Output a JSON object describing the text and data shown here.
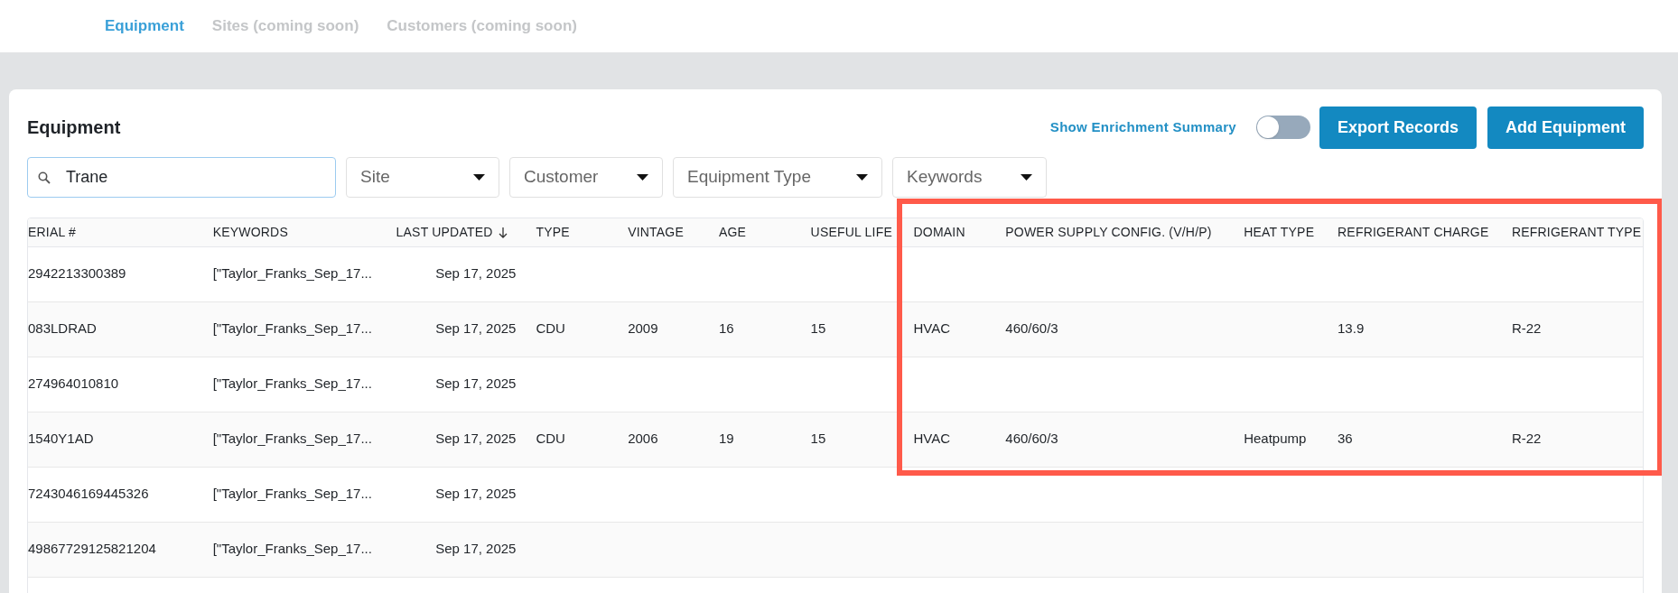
{
  "nav_tabs": [
    {
      "label": "Equipment",
      "selected": true
    },
    {
      "label": "Sites (coming soon)",
      "selected": false
    },
    {
      "label": "Customers (coming soon)",
      "selected": false
    }
  ],
  "card": {
    "title": "Equipment",
    "enrichment_toggle": {
      "label": "Show Enrichment Summary",
      "on": false
    },
    "buttons": [
      "Export Records",
      "Add Equipment"
    ]
  },
  "search": {
    "value": "Trane"
  },
  "filters": [
    "Site",
    "Customer",
    "Equipment Type",
    "Keywords"
  ],
  "table": {
    "columns": [
      "ERIAL #",
      "KEYWORDS",
      "LAST UPDATED",
      "TYPE",
      "VINTAGE",
      "AGE",
      "USEFUL LIFE",
      "DOMAIN",
      "POWER SUPPLY CONFIG. (V/H/P)",
      "HEAT TYPE",
      "REFRIGERANT CHARGE",
      "REFRIGERANT TYPE"
    ],
    "rows": [
      [
        "2942213300389",
        "[\"Taylor_Franks_Sep_17...",
        "Sep 17, 2025"
      ],
      [
        "083LDRAD",
        "[\"Taylor_Franks_Sep_17...",
        "Sep 17, 2025",
        "CDU",
        "2009",
        "16",
        "15",
        "HVAC",
        "460/60/3",
        null,
        "13.9",
        "R-22"
      ],
      [
        "274964010810",
        "[\"Taylor_Franks_Sep_17...",
        "Sep 17, 2025"
      ],
      [
        "1540Y1AD",
        "[\"Taylor_Franks_Sep_17...",
        "Sep 17, 2025",
        "CDU",
        "2006",
        "19",
        "15",
        "HVAC",
        "460/60/3",
        "Heatpump",
        "36",
        "R-22"
      ],
      [
        "7243046169445326",
        "[\"Taylor_Franks_Sep_17...",
        "Sep 17, 2025"
      ],
      [
        "49867729125821204",
        "[\"Taylor_Franks_Sep_17...",
        "Sep 17, 2025"
      ]
    ]
  }
}
